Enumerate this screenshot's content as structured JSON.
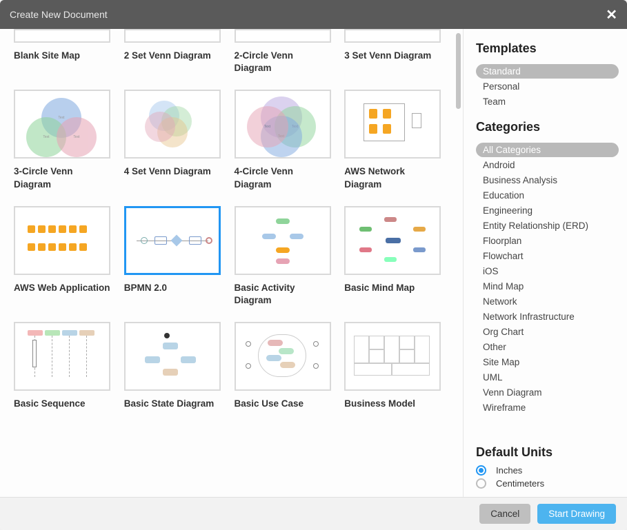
{
  "dialog": {
    "title": "Create New Document"
  },
  "gallery": {
    "items": [
      {
        "label": "Blank Site Map",
        "kind": "blank-short"
      },
      {
        "label": "2 Set Venn Diagram",
        "kind": "blank-short"
      },
      {
        "label": "2-Circle Venn Diagram",
        "kind": "blank-short"
      },
      {
        "label": "3 Set Venn Diagram",
        "kind": "blank-short"
      },
      {
        "label": "3-Circle Venn Diagram",
        "kind": "venn3"
      },
      {
        "label": "4 Set Venn Diagram",
        "kind": "venn4s"
      },
      {
        "label": "4-Circle Venn Diagram",
        "kind": "venn4c"
      },
      {
        "label": "AWS Network Diagram",
        "kind": "awsnet"
      },
      {
        "label": "AWS Web Application",
        "kind": "awsweb"
      },
      {
        "label": "BPMN 2.0",
        "kind": "bpmn",
        "selected": true
      },
      {
        "label": "Basic Activity Diagram",
        "kind": "activity"
      },
      {
        "label": "Basic Mind Map",
        "kind": "mindmap"
      },
      {
        "label": "Basic Sequence",
        "kind": "seq"
      },
      {
        "label": "Basic State Diagram",
        "kind": "state"
      },
      {
        "label": "Basic Use Case",
        "kind": "usecase"
      },
      {
        "label": "Business Model",
        "kind": "bmc"
      }
    ]
  },
  "sidebar": {
    "templates_heading": "Templates",
    "template_scopes": [
      {
        "label": "Standard",
        "selected": true
      },
      {
        "label": "Personal"
      },
      {
        "label": "Team"
      }
    ],
    "categories_heading": "Categories",
    "categories": [
      {
        "label": "All Categories",
        "selected": true
      },
      {
        "label": "Android"
      },
      {
        "label": "Business Analysis"
      },
      {
        "label": "Education"
      },
      {
        "label": "Engineering"
      },
      {
        "label": "Entity Relationship (ERD)"
      },
      {
        "label": "Floorplan"
      },
      {
        "label": "Flowchart"
      },
      {
        "label": "iOS"
      },
      {
        "label": "Mind Map"
      },
      {
        "label": "Network"
      },
      {
        "label": "Network Infrastructure"
      },
      {
        "label": "Org Chart"
      },
      {
        "label": "Other"
      },
      {
        "label": "Site Map"
      },
      {
        "label": "UML"
      },
      {
        "label": "Venn Diagram"
      },
      {
        "label": "Wireframe"
      }
    ],
    "units_heading": "Default Units",
    "units": [
      {
        "label": "Inches",
        "selected": true
      },
      {
        "label": "Centimeters"
      }
    ]
  },
  "footer": {
    "cancel_label": "Cancel",
    "start_label": "Start Drawing"
  },
  "accent_color": "#4db4ef"
}
